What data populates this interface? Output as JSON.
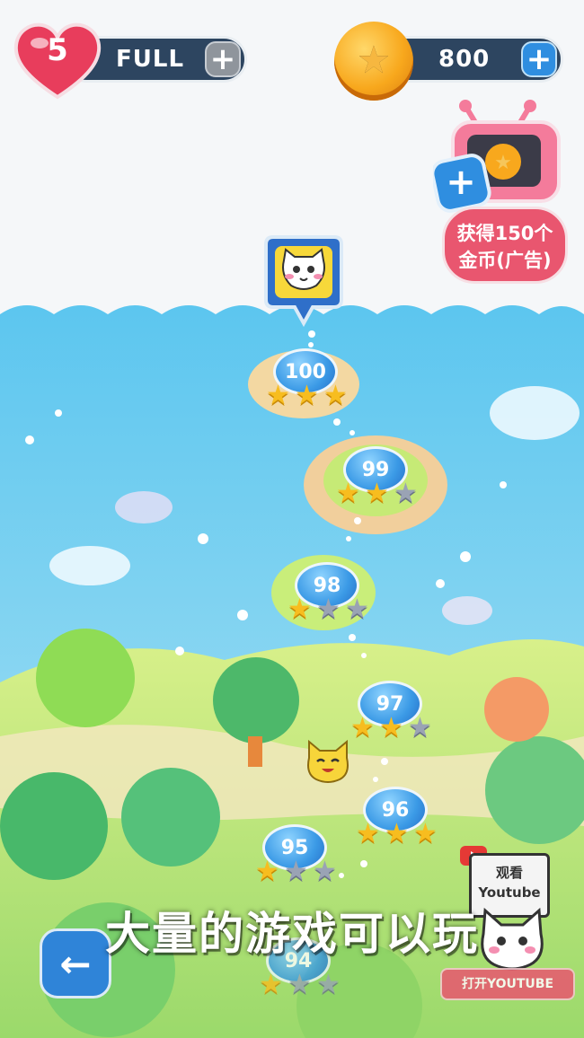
{
  "hud": {
    "lives": "5",
    "lives_status": "FULL",
    "coins": "800"
  },
  "reward_ad": {
    "label_line1": "获得150个",
    "label_line2": "金币(广告)"
  },
  "levels": [
    {
      "number": "100",
      "stars": 3
    },
    {
      "number": "99",
      "stars": 2
    },
    {
      "number": "98",
      "stars": 1
    },
    {
      "number": "97",
      "stars": 2
    },
    {
      "number": "96",
      "stars": 3
    },
    {
      "number": "95",
      "stars": 1
    },
    {
      "number": "94",
      "stars": 1
    }
  ],
  "youtube": {
    "watch_line1": "观看",
    "watch_line2": "Youtube",
    "open_label": "打开YOUTUBE"
  },
  "caption": "大量的游戏可以玩",
  "colors": {
    "hud_pill": "#2d4560",
    "heart": "#e83d5c",
    "coin": "#f8a81d",
    "level_bubble": "#3b9ae6",
    "star_on": "#f7bd1f",
    "star_off": "#9aa3b4",
    "ad_pill": "#e9566f"
  },
  "icons": [
    "heart-icon",
    "plus-icon",
    "coin-icon",
    "tv-icon",
    "cat-marker-icon",
    "cat-face-icon",
    "back-arrow-icon",
    "youtube-icon"
  ]
}
